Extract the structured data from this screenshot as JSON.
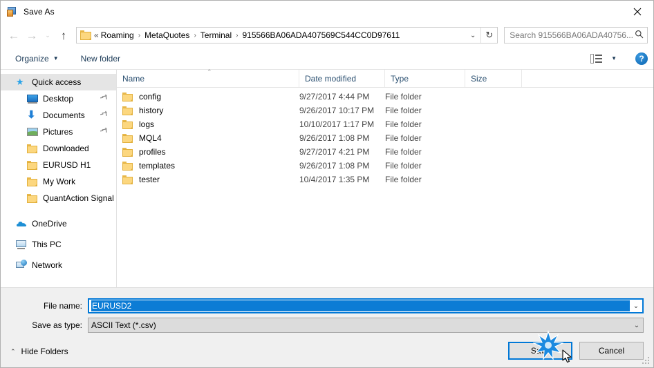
{
  "window": {
    "title": "Save As",
    "title_icon": "save-as-app-icon",
    "close_label": "✕"
  },
  "nav": {
    "back_icon": "←",
    "forward_icon": "→",
    "recent_icon": "⌄",
    "up_icon": "↑",
    "refresh_icon": "↻",
    "dropdown_icon": "⌄",
    "breadcrumb_prefix": "«",
    "breadcrumb": [
      "Roaming",
      "MetaQuotes",
      "Terminal",
      "915566BA06ADA407569C544CC0D97611"
    ],
    "separator": "›"
  },
  "search": {
    "placeholder": "Search 915566BA06ADA40756...",
    "icon": "⌕"
  },
  "toolbar": {
    "organize_label": "Organize",
    "organize_caret": "▼",
    "new_folder_label": "New folder",
    "view_caret": "▼",
    "help_label": "?"
  },
  "sidebar": {
    "items": [
      {
        "label": "Quick access",
        "icon": "star-icon",
        "selected": true,
        "pinned": false,
        "indent": false
      },
      {
        "label": "Desktop",
        "icon": "desktop-icon",
        "selected": false,
        "pinned": true,
        "indent": true
      },
      {
        "label": "Documents",
        "icon": "documents-download-icon",
        "selected": false,
        "pinned": true,
        "indent": true
      },
      {
        "label": "Pictures",
        "icon": "pictures-icon",
        "selected": false,
        "pinned": true,
        "indent": true
      },
      {
        "label": "Downloaded",
        "icon": "folder-icon",
        "selected": false,
        "pinned": false,
        "indent": true
      },
      {
        "label": "EURUSD H1",
        "icon": "folder-icon",
        "selected": false,
        "pinned": false,
        "indent": true
      },
      {
        "label": "My Work",
        "icon": "folder-icon",
        "selected": false,
        "pinned": false,
        "indent": true
      },
      {
        "label": "QuantAction Signal",
        "icon": "folder-icon",
        "selected": false,
        "pinned": false,
        "indent": true
      },
      {
        "label": "OneDrive",
        "icon": "onedrive-cloud-icon",
        "selected": false,
        "pinned": false,
        "indent": false
      },
      {
        "label": "This PC",
        "icon": "this-pc-icon",
        "selected": false,
        "pinned": false,
        "indent": false
      },
      {
        "label": "Network",
        "icon": "network-icon",
        "selected": false,
        "pinned": false,
        "indent": false
      }
    ],
    "pin_glyph": "📌"
  },
  "filelist": {
    "columns": [
      "Name",
      "Date modified",
      "Type",
      "Size"
    ],
    "sort_caret": "⌃",
    "rows": [
      {
        "name": "config",
        "date": "9/27/2017 4:44 PM",
        "type": "File folder",
        "size": ""
      },
      {
        "name": "history",
        "date": "9/26/2017 10:17 PM",
        "type": "File folder",
        "size": ""
      },
      {
        "name": "logs",
        "date": "10/10/2017 1:17 PM",
        "type": "File folder",
        "size": ""
      },
      {
        "name": "MQL4",
        "date": "9/26/2017 1:08 PM",
        "type": "File folder",
        "size": ""
      },
      {
        "name": "profiles",
        "date": "9/27/2017 4:21 PM",
        "type": "File folder",
        "size": ""
      },
      {
        "name": "templates",
        "date": "9/26/2017 1:08 PM",
        "type": "File folder",
        "size": ""
      },
      {
        "name": "tester",
        "date": "10/4/2017 1:35 PM",
        "type": "File folder",
        "size": ""
      }
    ]
  },
  "form": {
    "filename_label": "File name:",
    "filename_value": "EURUSD2",
    "filetype_label": "Save as type:",
    "filetype_value": "ASCII Text (*.csv)",
    "combo_chevron": "⌄"
  },
  "footer": {
    "hide_folders_label": "Hide Folders",
    "hide_folders_caret": "⌃",
    "save_label": "Save",
    "cancel_label": "Cancel"
  },
  "colors": {
    "accent": "#0078d7",
    "click_burst": "#1c8ae0",
    "folder_yellow": "#fcd77f",
    "selection_gray": "#e5e5e5",
    "panel_gray": "#f0f0f0",
    "header_text": "#2a4f70"
  }
}
